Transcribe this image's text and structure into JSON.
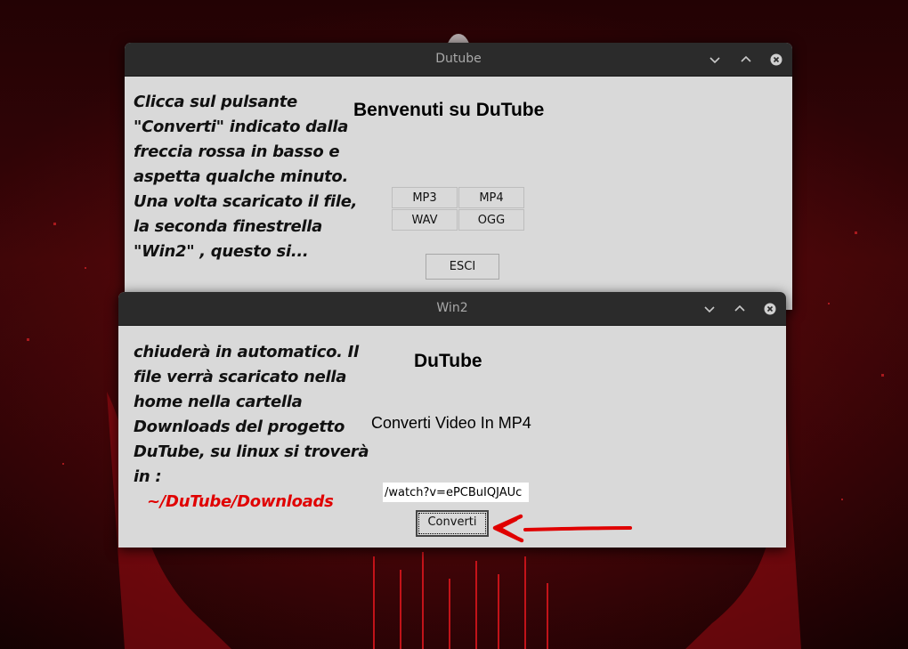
{
  "windows": {
    "main": {
      "title": "Dutube",
      "instructions": "Clicca sul pulsante\n\"Converti\" indicato dalla\nfreccia rossa in basso e\naspetta qualche minuto.\nUna volta scaricato il file,\nla seconda finestrella\n\"Win2\" , questo si...",
      "heading": "Benvenuti su DuTube",
      "formats": [
        "MP3",
        "MP4",
        "WAV",
        "OGG"
      ],
      "exit_label": "ESCI"
    },
    "win2": {
      "title": "Win2",
      "instructions": "chiuderà in automatico. Il\nfile verrà scaricato nella\nhome nella cartella\nDownloads del progetto\nDuTube, su linux si troverà\nin :",
      "path": "~/DuTube/Downloads",
      "heading": "DuTube",
      "subheading": "Converti Video In MP4",
      "url_value": "/watch?v=ePCBuIQJAUc",
      "convert_label": "Converti"
    }
  },
  "colors": {
    "titlebar": "#2b2b2b",
    "window_bg": "#d9d9d9",
    "title_text": "#a9a9a9",
    "path_text": "#e00000",
    "arrow": "#e00000"
  },
  "icons": [
    "minimize-icon",
    "maximize-icon",
    "close-icon",
    "red-arrow-annotation"
  ]
}
